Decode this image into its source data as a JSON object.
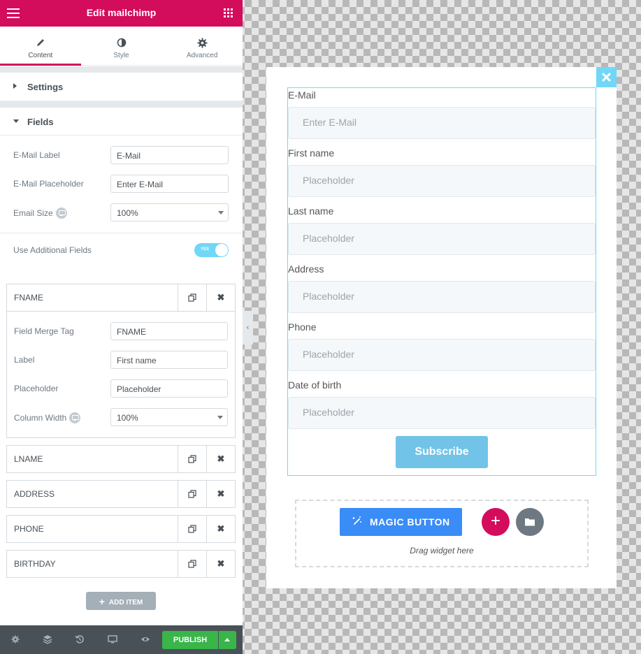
{
  "panel": {
    "title": "Edit mailchimp",
    "tabs": [
      {
        "label": "Content",
        "icon": "pencil-icon"
      },
      {
        "label": "Style",
        "icon": "contrast-icon"
      },
      {
        "label": "Advanced",
        "icon": "gear-icon"
      }
    ],
    "settings_label": "Settings",
    "fields_label": "Fields",
    "email_label": {
      "label": "E-Mail Label",
      "value": "E-Mail"
    },
    "email_placeholder": {
      "label": "E-Mail Placeholder",
      "value": "Enter E-Mail"
    },
    "email_size": {
      "label": "Email Size",
      "value": "100%"
    },
    "additional_fields": {
      "label": "Use Additional Fields",
      "toggle_text": "YES",
      "on": true
    },
    "repeater_items": [
      "FNAME",
      "LNAME",
      "ADDRESS",
      "PHONE",
      "BIRTHDAY"
    ],
    "fname_expanded": {
      "merge_tag": {
        "label": "Field Merge Tag",
        "value": "FNAME"
      },
      "label": {
        "label": "Label",
        "value": "First name"
      },
      "placeholder": {
        "label": "Placeholder",
        "value": "Placeholder"
      },
      "column_width": {
        "label": "Column Width",
        "value": "100%"
      }
    },
    "add_item": "ADD ITEM",
    "publish": "PUBLISH"
  },
  "preview": {
    "fields": [
      {
        "label": "E-Mail",
        "placeholder": "Enter E-Mail"
      },
      {
        "label": "First name",
        "placeholder": "Placeholder"
      },
      {
        "label": "Last name",
        "placeholder": "Placeholder"
      },
      {
        "label": "Address",
        "placeholder": "Placeholder"
      },
      {
        "label": "Phone",
        "placeholder": "Placeholder"
      },
      {
        "label": "Date of birth",
        "placeholder": "Placeholder"
      }
    ],
    "subscribe": "Subscribe",
    "magic_button": "MAGIC BUTTON",
    "drag_text": "Drag widget here"
  },
  "colors": {
    "brand": "#d30c5c",
    "accent": "#71d7f7",
    "publish": "#39b54a",
    "magic": "#3a8cf7",
    "subscribe": "#71c3e7"
  }
}
